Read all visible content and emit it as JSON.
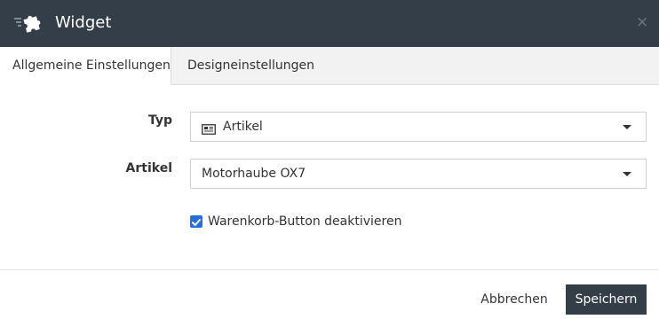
{
  "dialog": {
    "title": "Widget",
    "header_icon": "puzzle-icon",
    "close_icon": "close-icon",
    "close_glyph": "×",
    "header_color": "#333e48"
  },
  "tabs": [
    {
      "label": "Allgemeine Einstellungen",
      "active": true
    },
    {
      "label": "Designeinstellungen",
      "active": false
    }
  ],
  "form": {
    "type_label": "Typ",
    "type_value": "Artikel",
    "type_icon": "article-icon",
    "article_label": "Artikel",
    "article_value": "Motorhaube OX7",
    "checkbox_label": "Warenkorb-Button deaktivieren",
    "checkbox_checked": true,
    "checkbox_color": "#2a6dd4"
  },
  "footer": {
    "cancel_label": "Abbrechen",
    "save_label": "Speichern"
  }
}
